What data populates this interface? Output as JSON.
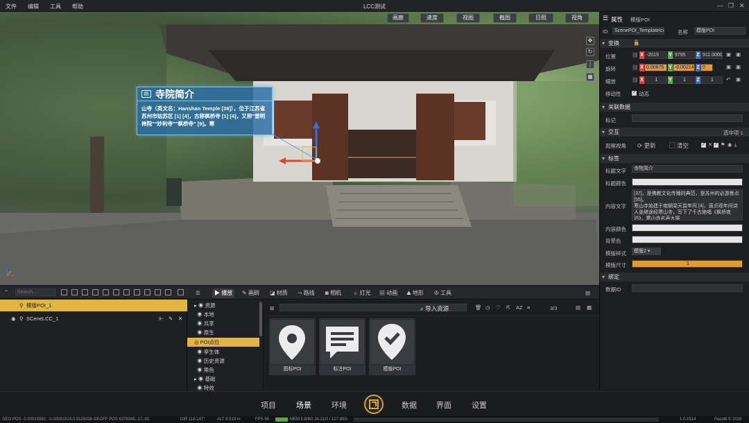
{
  "app": {
    "title": "LCC测试",
    "menus": [
      "文件",
      "编辑",
      "工具",
      "帮助"
    ]
  },
  "window_controls": {
    "minimize": "—",
    "restore": "❐",
    "close": "✕"
  },
  "viewport_toolbar": [
    {
      "label": "画廊"
    },
    {
      "label": "速度"
    },
    {
      "label": "视图"
    },
    {
      "label": "截图"
    },
    {
      "label": "日照"
    },
    {
      "label": "视角"
    }
  ],
  "poi_label": {
    "title": "寺院简介",
    "body": "山寺（英文名：Hanshan Temple [38]），位于江苏省苏州市姑苏区 [1] [4]，古称枫桥寺 [1] [4]，又称\"普明禅院\"\"妙利寺\"\"枫桥寺\" [9]。寒"
  },
  "properties": {
    "header": {
      "label": "属性",
      "value": "模版POI"
    },
    "id": {
      "label": "ID",
      "value": "ScenePOI_TemplateIcon",
      "name_label": "名称",
      "name_value": "模版POI"
    },
    "transform": {
      "title": "变换",
      "position": {
        "label": "位置",
        "x": "-2019",
        "y": "9795",
        "z": "911.00000"
      },
      "rotation": {
        "label": "旋转",
        "x": "0.00875",
        "y": "-0.00214",
        "z": "0"
      },
      "scale": {
        "label": "缩放",
        "x": "1",
        "y": "1",
        "z": "1"
      },
      "movable": {
        "label": "移动性",
        "value": "动态"
      }
    },
    "related": {
      "title": "关联数据",
      "tag_label": "标记"
    },
    "interaction": {
      "title": "交互",
      "selected": "选中项 1",
      "view_label": "观察视角",
      "update": "更新",
      "clear": "清空"
    },
    "tags": {
      "title": "标签",
      "title_text_label": "标题文字",
      "title_text": "寺院简介",
      "title_color_label": "标题颜色",
      "content_label": "内容文字",
      "content": "[37]，是佛教文化传播的典范，是苏州的必游景点 [55]。\n寒山寺始建于南朝梁天监年间 [4]，唐贞观年间诗人张继途经寒山寺，写下了千古绝唱《枫桥夜泊》，寒山寺名声大振",
      "content_color_label": "内容颜色",
      "bg_color_label": "背景色",
      "template_style_label": "模版样式",
      "template_style": "模版2 ▾",
      "template_size_label": "模版尺寸",
      "template_size": "1"
    },
    "binding": {
      "title": "绑定",
      "data_id_label": "数据ID"
    }
  },
  "outliner": {
    "search_placeholder": "Search...",
    "items": [
      {
        "label": "模版POI_1"
      },
      {
        "label": "SCeneLCC_1"
      }
    ]
  },
  "assets": {
    "tabs": [
      {
        "label": "播放"
      },
      {
        "label": "画刷"
      },
      {
        "label": "材质"
      },
      {
        "label": "路线"
      },
      {
        "label": "相机"
      },
      {
        "label": "灯光"
      },
      {
        "label": "动画"
      },
      {
        "label": "地形"
      },
      {
        "label": "工具"
      }
    ],
    "import_label": "导入资源",
    "page": "3/3",
    "tree": [
      {
        "label": "资源"
      },
      {
        "label": "本地"
      },
      {
        "label": "共享"
      },
      {
        "label": "原生"
      },
      {
        "label": "POI点位"
      },
      {
        "label": "孪生体"
      },
      {
        "label": "历史资源"
      },
      {
        "label": "角色"
      },
      {
        "label": "基础"
      },
      {
        "label": "特效"
      }
    ],
    "cards": [
      {
        "label": "图标POI"
      },
      {
        "label": "标注POI"
      },
      {
        "label": "模版POI"
      }
    ]
  },
  "bottom_nav": {
    "left": [
      "项目",
      "场景",
      "环境"
    ],
    "right": [
      "数据",
      "界面",
      "设置"
    ]
  },
  "status": {
    "left": "GEO POS -0.00015982, -0.00082314,0.9125038 GEOFF POS 6378345,-17,-91",
    "dir": "DIR 118.147°",
    "alt": "ALT 8.513 m",
    "fps": "FPS 56",
    "mem": "MEM 5.8/8G 24.21G / 127.89G",
    "version": "1.0.1614",
    "copyright": "Pacotti © 2026"
  }
}
